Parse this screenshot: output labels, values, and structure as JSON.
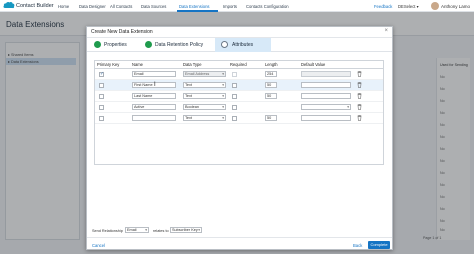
{
  "app": {
    "name": "Contact Builder",
    "nav_tabs": [
      "Home",
      "Data Designer",
      "All Contacts",
      "Data Sources",
      "Data Extensions",
      "Imports",
      "Contacts Configuration"
    ],
    "active_tab": "Data Extensions",
    "feedback": "Feedback",
    "business_unit": "DESelect",
    "user_name": "Anthony Lamo"
  },
  "page": {
    "title": "Data Extensions",
    "folders": [
      "Shared Items",
      "Data Extensions"
    ],
    "right_column_header": "Used for Sending",
    "right_column_values": [
      "No",
      "No",
      "No",
      "No",
      "No",
      "No",
      "No",
      "No",
      "No",
      "No",
      "No",
      "No",
      "No",
      "No"
    ],
    "pager": "Page 1 of 1"
  },
  "modal": {
    "title": "Create New Data Extension",
    "steps": [
      {
        "label": "Properties",
        "status": "complete"
      },
      {
        "label": "Data Retention Policy",
        "status": "complete"
      },
      {
        "label": "Attributes",
        "status": "current"
      }
    ],
    "columns": [
      "Primary Key",
      "Name",
      "Data Type",
      "Required",
      "Length",
      "Default Value"
    ],
    "rows": [
      {
        "primary": true,
        "name": "Email",
        "type": "Email Address",
        "required": false,
        "length": "254",
        "default_disabled": true
      },
      {
        "primary": false,
        "name": "First Name",
        "type": "Text",
        "required": false,
        "length": "50",
        "default_disabled": false
      },
      {
        "primary": false,
        "name": "Last Name",
        "type": "Text",
        "required": false,
        "length": "50",
        "default_disabled": false
      },
      {
        "primary": false,
        "name": "Active",
        "type": "Boolean",
        "required": false,
        "length": "",
        "default_disabled": false
      },
      {
        "primary": false,
        "name": "",
        "type": "Text",
        "required": false,
        "length": "50",
        "default_disabled": false
      }
    ],
    "relationship_label": "Send Relationship",
    "relationship_field": "Email",
    "relates_to": "relates to",
    "relationship_target": "Subscriber Key",
    "cancel": "Cancel",
    "back": "Back",
    "complete": "Complete"
  },
  "colors": {
    "accent": "#1574c4",
    "step_done": "#1f9b4d",
    "step_current_bg": "#d7e9f8"
  }
}
